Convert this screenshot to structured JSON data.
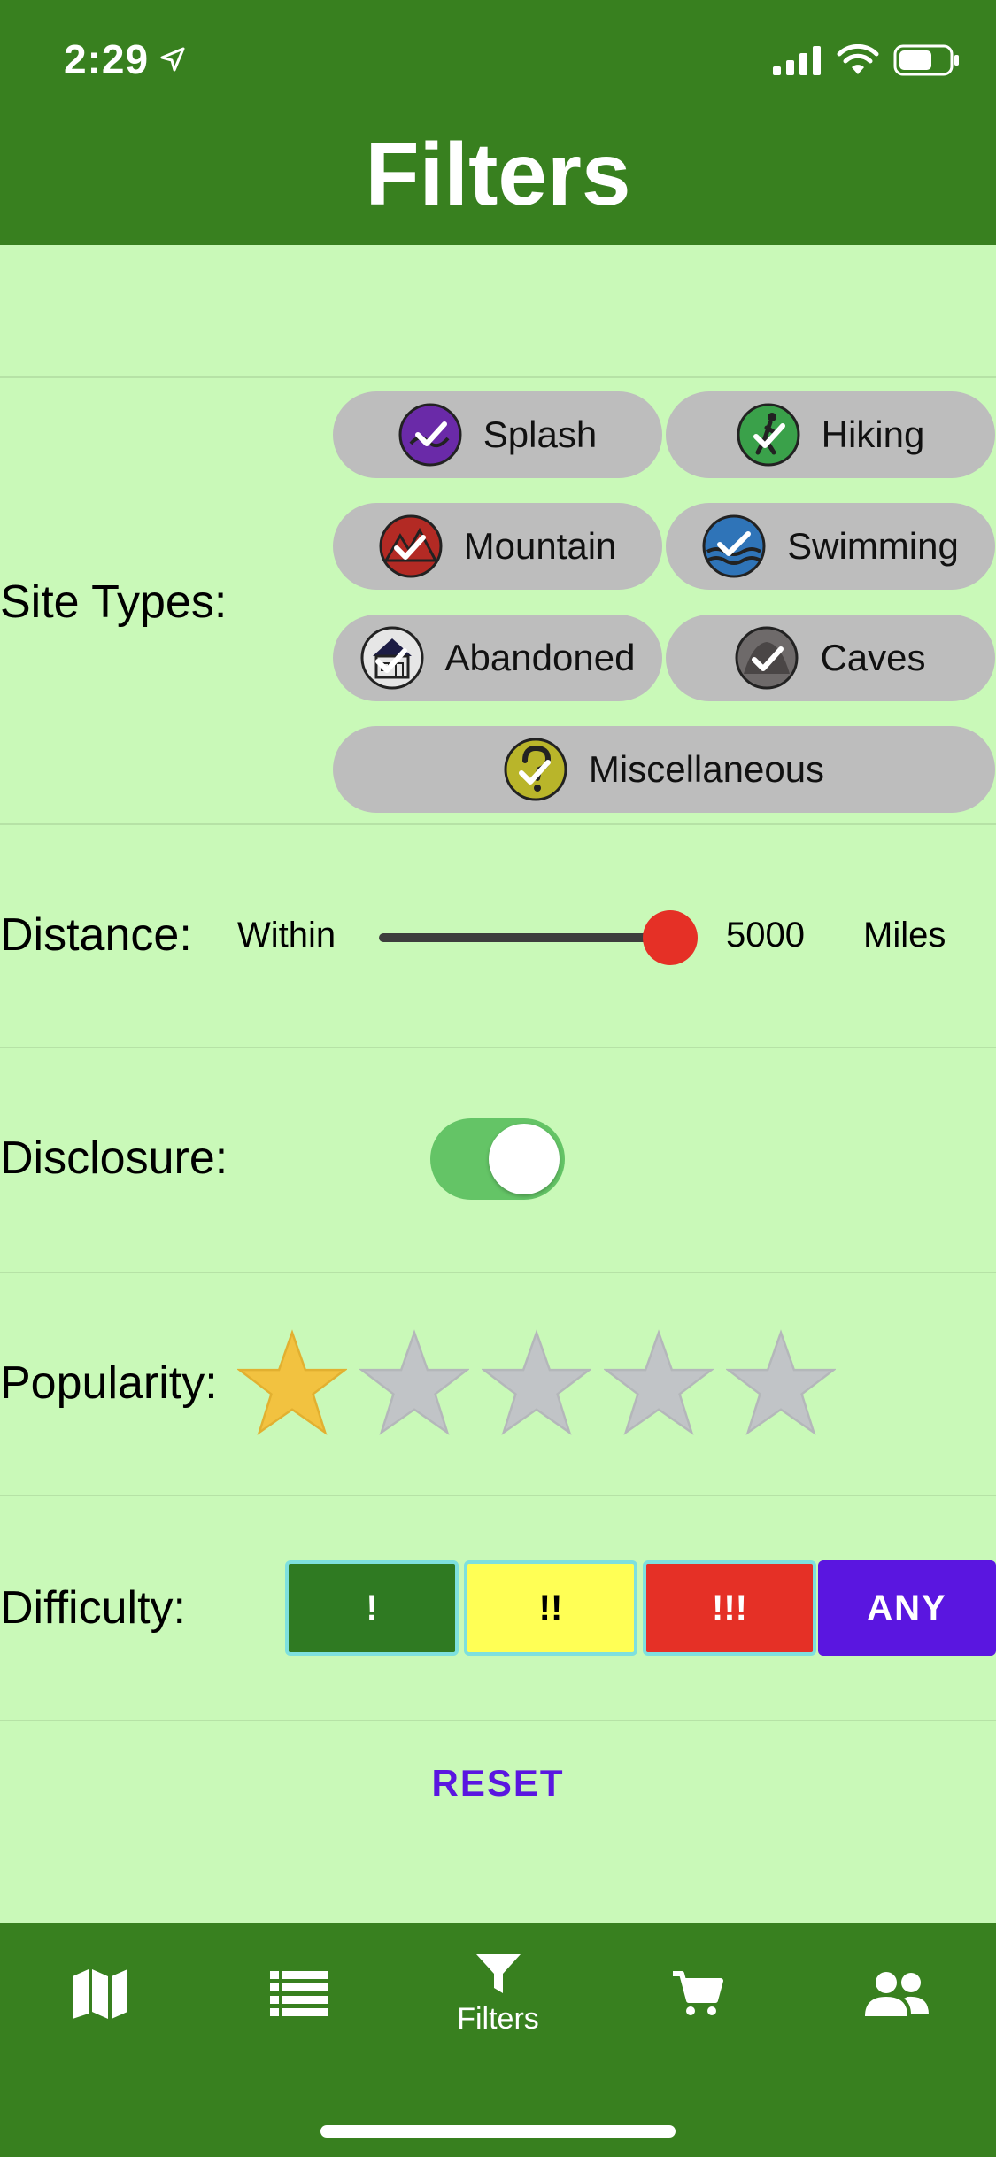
{
  "status_bar": {
    "time": "2:29"
  },
  "header": {
    "title": "Filters"
  },
  "site_types": {
    "label": "Site Types:",
    "chips": [
      {
        "label": "Splash",
        "icon": "splash-icon",
        "color": "#6a2aa8",
        "checked": true
      },
      {
        "label": "Hiking",
        "icon": "hiking-icon",
        "color": "#3aa14a",
        "checked": true
      },
      {
        "label": "Mountain",
        "icon": "mountain-icon",
        "color": "#b32a24",
        "checked": true
      },
      {
        "label": "Swimming",
        "icon": "swimming-icon",
        "color": "#2f74b8",
        "checked": true
      },
      {
        "label": "Abandoned",
        "icon": "abandoned-icon",
        "color": "#d9d9d9",
        "checked": true
      },
      {
        "label": "Caves",
        "icon": "caves-icon",
        "color": "#6e6a6a",
        "checked": true
      },
      {
        "label": "Miscellaneous",
        "icon": "miscellaneous-icon",
        "color": "#b9b52a",
        "checked": true
      }
    ]
  },
  "distance": {
    "label": "Distance:",
    "prefix": "Within",
    "value": "5000",
    "unit": "Miles",
    "slider_fraction": 1.0
  },
  "disclosure": {
    "label": "Disclosure:",
    "on": true
  },
  "popularity": {
    "label": "Popularity:",
    "rating": 1,
    "max": 5
  },
  "difficulty": {
    "label": "Difficulty:",
    "options": [
      {
        "label": "!",
        "bg": "#2f7a22",
        "fg": "#ffffff"
      },
      {
        "label": "!!",
        "bg": "#ffff55",
        "fg": "#000000"
      },
      {
        "label": "!!!",
        "bg": "#e53026",
        "fg": "#ffffff"
      },
      {
        "label": "ANY",
        "bg": "#5a16e0",
        "fg": "#ffffff"
      }
    ]
  },
  "reset_label": "RESET",
  "tabbar": {
    "tabs": [
      {
        "icon": "map-icon",
        "label": ""
      },
      {
        "icon": "list-icon",
        "label": ""
      },
      {
        "icon": "filter-icon",
        "label": "Filters"
      },
      {
        "icon": "cart-icon",
        "label": ""
      },
      {
        "icon": "people-icon",
        "label": ""
      }
    ]
  },
  "colors": {
    "header": "#38801f",
    "background": "#c9f9b8",
    "accent": "#5a16e0"
  }
}
